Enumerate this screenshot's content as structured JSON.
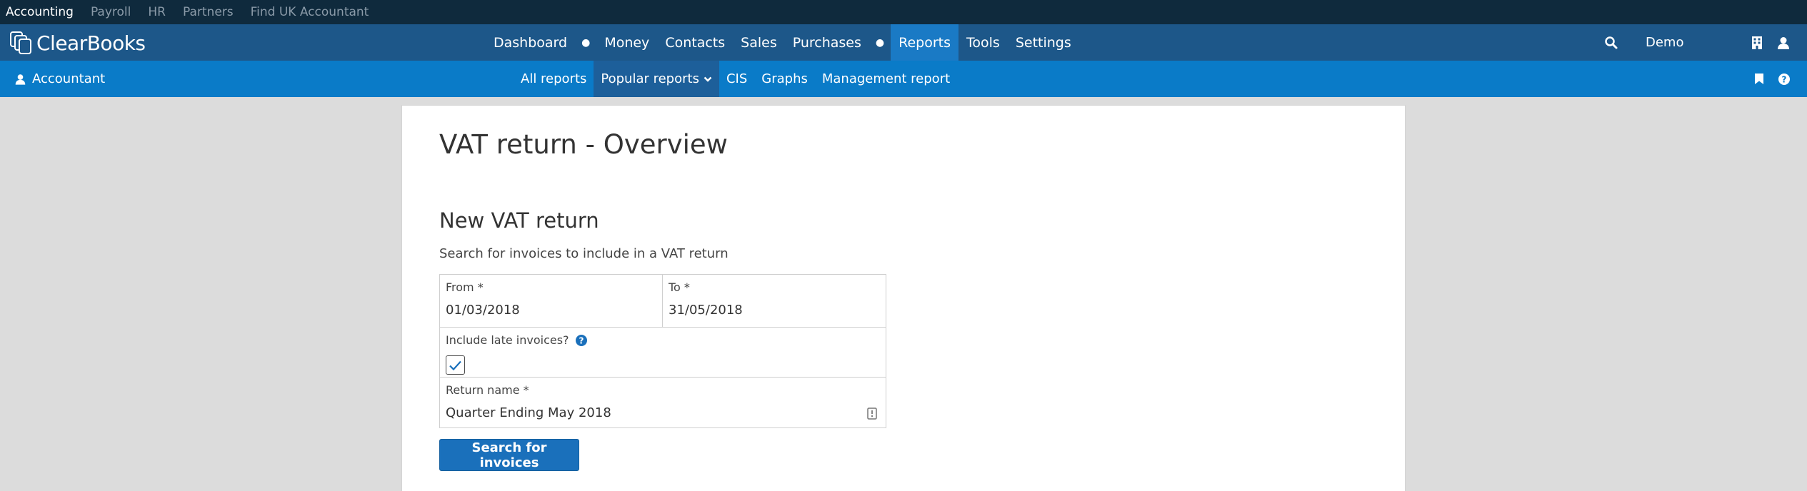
{
  "product_bar": {
    "items": [
      "Accounting",
      "Payroll",
      "HR",
      "Partners",
      "Find UK Accountant"
    ]
  },
  "main_nav": {
    "logo_text": "ClearBooks",
    "items": [
      "Dashboard",
      "Money",
      "Contacts",
      "Sales",
      "Purchases",
      "Reports",
      "Tools",
      "Settings"
    ],
    "active": "Reports",
    "company": "Demo",
    "icons": [
      "search-icon",
      "building-icon",
      "user-icon"
    ]
  },
  "sub_nav": {
    "role": "Accountant",
    "items": [
      "All reports",
      "Popular reports",
      "CIS",
      "Graphs",
      "Management report"
    ],
    "active": "Popular reports",
    "icons": [
      "bookmark-icon",
      "help-icon"
    ]
  },
  "page": {
    "title": "VAT return - Overview",
    "section_title": "New VAT return",
    "section_desc": "Search for invoices to include in a VAT return",
    "from_label": "From *",
    "from_value": "01/03/2018",
    "to_label": "To *",
    "to_value": "31/05/2018",
    "late_label": "Include late invoices?",
    "late_checked": true,
    "name_label": "Return name *",
    "name_value": "Quarter Ending May 2018",
    "search_button": "Search for invoices"
  },
  "colors": {
    "product_bar": "#0f2a3d",
    "main_nav": "#1d5789",
    "nav_active": "#1a7ac5",
    "sub_nav": "#0a7bc8",
    "button": "#1a70bb"
  }
}
